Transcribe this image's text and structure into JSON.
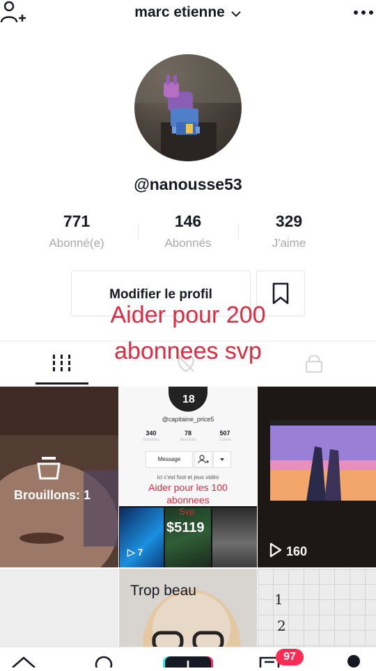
{
  "header": {
    "title": "marc etienne"
  },
  "profile": {
    "username": "@nanousse53"
  },
  "stats": [
    {
      "value": "771",
      "label": "Abonné(e)"
    },
    {
      "value": "146",
      "label": "Abonnés"
    },
    {
      "value": "329",
      "label": "J'aime"
    }
  ],
  "actions": {
    "edit_label": "Modifier le profil"
  },
  "overlay": {
    "line1": "Aider pour 200",
    "line2": "abonnees svp"
  },
  "grid": {
    "drafts_label": "Brouillons: 1",
    "views_3": "160"
  },
  "inner_profile": {
    "username": "@capitaine_price5",
    "stats": [
      {
        "value": "340",
        "label": "Abonnés"
      },
      {
        "value": "78",
        "label": "Abonnés"
      },
      {
        "value": "507",
        "label": "J'aime"
      }
    ],
    "message_label": "Message",
    "bio": "ici c'est foot et jeux vidéo",
    "caption1": "Aider pour les 100",
    "caption2": "abonnees",
    "thumb2_text": "Svp",
    "thumb2_money": "$5119",
    "thumb1_views": "7"
  },
  "cell5_text": "Trop beau",
  "cell6_text": [
    "1",
    "2"
  ],
  "nav": {
    "inbox_badge": "97"
  },
  "colors": {
    "accent": "#fe2c55",
    "caption": "#e0283f",
    "text": "#161823",
    "muted": "#a8a9ad"
  }
}
